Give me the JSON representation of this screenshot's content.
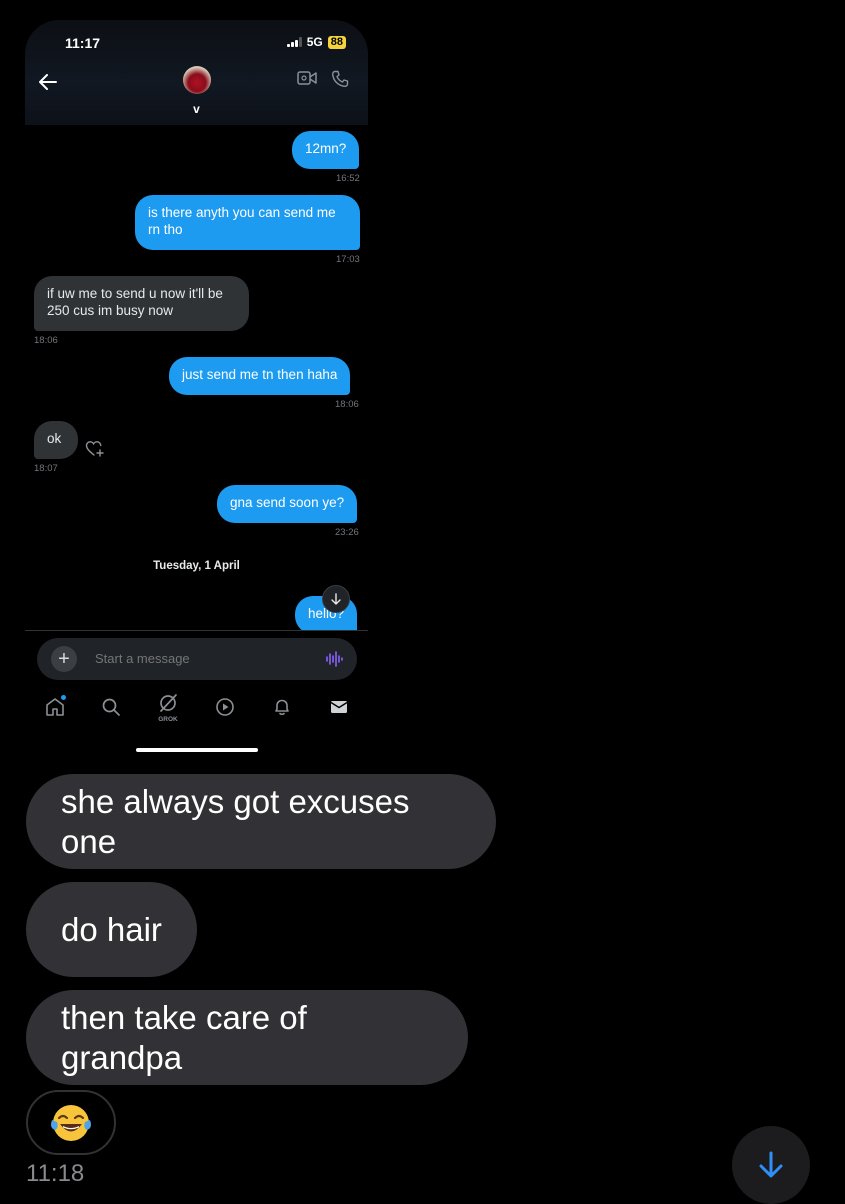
{
  "phone": {
    "status": {
      "time": "11:17",
      "network": "5G",
      "battery": "88"
    },
    "contact": {
      "name": "v"
    },
    "messages": [
      {
        "text": "12mn?",
        "time": "16:52",
        "dir": "out"
      },
      {
        "text": "is there anyth you can send me rn tho",
        "time": "17:03",
        "dir": "out"
      },
      {
        "text": "if uw me to send u now it'll be 250 cus im busy now",
        "time": "18:06",
        "dir": "in"
      },
      {
        "text": "just send me tn then haha",
        "time": "18:06",
        "dir": "out"
      },
      {
        "text": "ok",
        "time": "18:07",
        "dir": "in"
      },
      {
        "text": "gna send soon ye?",
        "time": "23:26",
        "dir": "out"
      },
      {
        "text": "hello?",
        "time": "",
        "dir": "out"
      }
    ],
    "date_separator": "Tuesday, 1 April",
    "composer": {
      "placeholder": "Start a message"
    },
    "tabs": {
      "grok_label": "GROK"
    }
  },
  "chat": {
    "messages": [
      {
        "text": "she always got excuses one"
      },
      {
        "text": "do hair"
      },
      {
        "text": "then take care of grandpa"
      }
    ],
    "emoji": "😂",
    "time": "11:18"
  },
  "colors": {
    "outgoing": "#1d9bf0",
    "incoming_phone": "#2f3336",
    "incoming_chat": "#323236",
    "background": "#000000"
  },
  "icons": [
    "back-arrow-icon",
    "video-call-icon",
    "phone-call-icon",
    "heart-plus-icon",
    "arrow-down-icon",
    "plus-icon",
    "voice-wave-icon",
    "home-icon",
    "search-icon",
    "grok-icon",
    "play-icon",
    "bell-icon",
    "mail-icon"
  ]
}
